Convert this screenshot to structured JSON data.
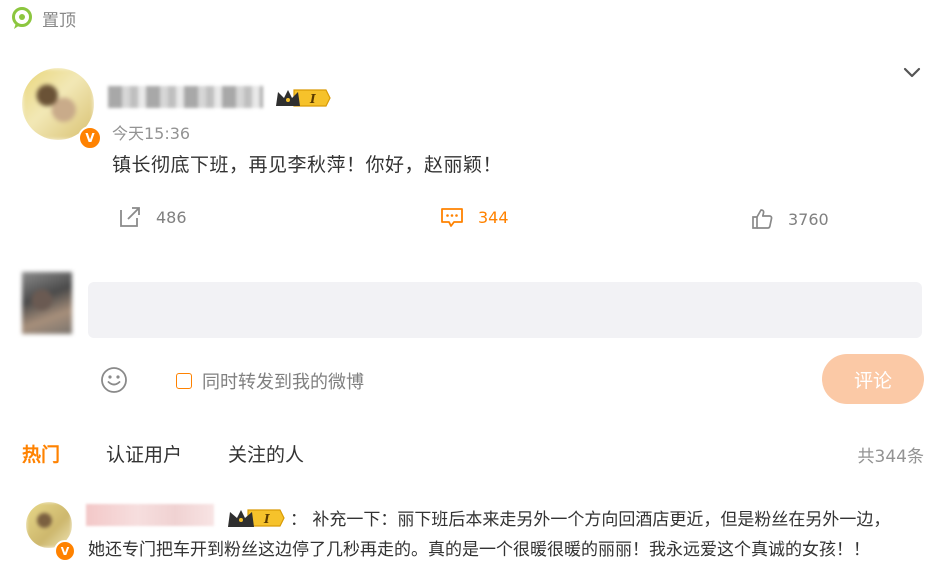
{
  "pin": {
    "label": "置顶",
    "icon": "pin-icon"
  },
  "post": {
    "time": "今天15:36",
    "content": "镇长彻底下班，再见李秋萍！你好，赵丽颖！",
    "actions": {
      "repost": {
        "icon": "repost-icon",
        "count": "486"
      },
      "comment": {
        "icon": "comment-icon",
        "count": "344"
      },
      "like": {
        "icon": "like-icon",
        "count": "3760"
      }
    },
    "verified_mark": "V",
    "badge_level": "I"
  },
  "composer": {
    "input_value": "",
    "sync_label": "同时转发到我的微博",
    "submit_label": "评论",
    "emoji_icon": "emoji-icon"
  },
  "filters": {
    "tabs": [
      "热门",
      "认证用户",
      "关注的人"
    ],
    "total": "共344条"
  },
  "comments": [
    {
      "verified_mark": "V",
      "badge_level": "I",
      "text_line1": "：  补充一下：丽下班后本来走另外一个方向回酒店更近，但是粉丝在另外一边，",
      "text_line2": "她还专门把车开到粉丝这边停了几秒再走的。真的是一个很暖很暖的丽丽！我永远爱这个真诚的女孩！！"
    }
  ],
  "colors": {
    "accent": "#ff8200",
    "submit_disabled": "#fbc9a6",
    "input_bg": "#f2f2f5",
    "muted": "#939393"
  }
}
